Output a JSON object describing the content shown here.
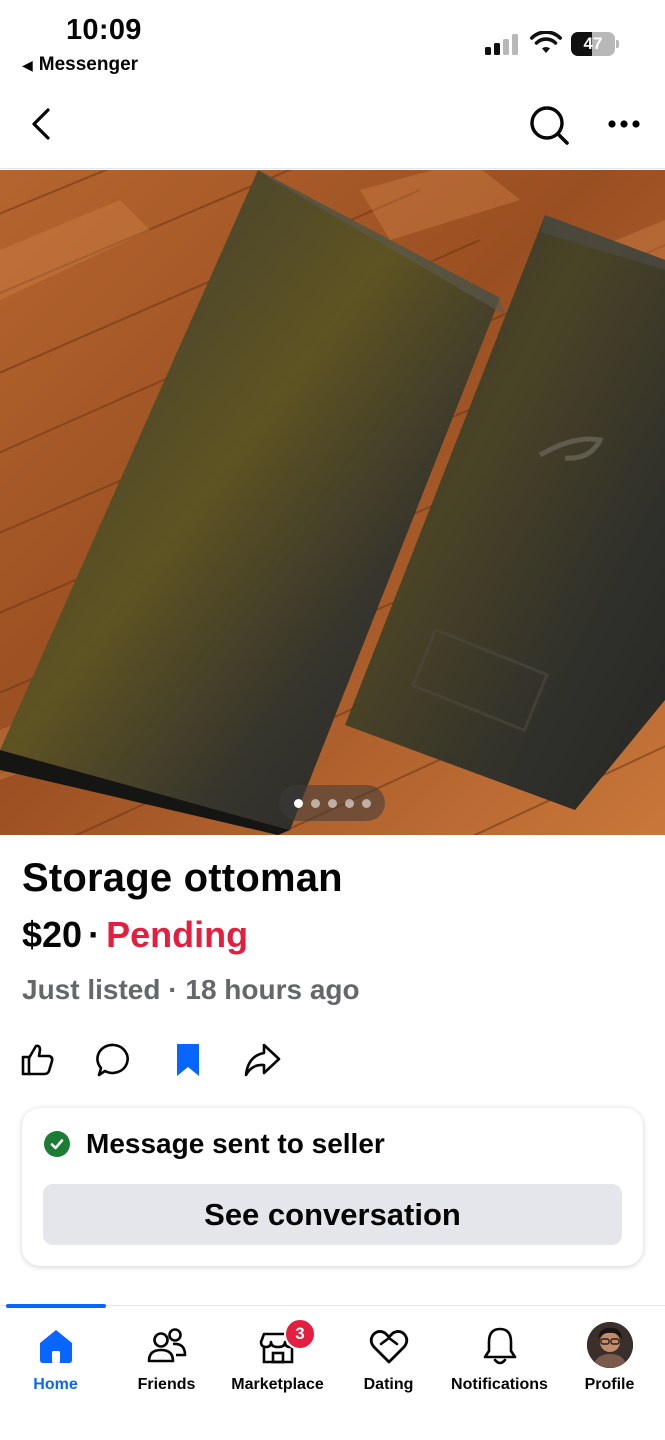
{
  "status_bar": {
    "time": "10:09",
    "back_app": "Messenger",
    "battery_level": "47",
    "battery_fraction": 0.47
  },
  "top_nav": {
    "back_icon": "chevron-left-icon",
    "search_icon": "search-icon",
    "more_icon": "more-horizontal-icon"
  },
  "photo": {
    "carousel_count": 5,
    "carousel_active_index": 0
  },
  "listing": {
    "title": "Storage ottoman",
    "price": "$20",
    "separator": "·",
    "status": "Pending",
    "meta": "Just listed · 18 hours ago",
    "status_color": "#e41e3f"
  },
  "actions": {
    "like_icon": "thumbs-up-icon",
    "comment_icon": "comment-icon",
    "save_icon": "bookmark-filled-icon",
    "share_icon": "share-icon"
  },
  "message_card": {
    "status_text": "Message sent to seller",
    "button_label": "See conversation",
    "check_color": "#1b7d33"
  },
  "tabbar": {
    "active_color": "#0866ff",
    "tabs": [
      {
        "label": "Home",
        "icon": "home-icon",
        "active": true
      },
      {
        "label": "Friends",
        "icon": "friends-icon",
        "active": false
      },
      {
        "label": "Marketplace",
        "icon": "marketplace-icon",
        "active": false,
        "badge": "3"
      },
      {
        "label": "Dating",
        "icon": "heart-icon",
        "active": false
      },
      {
        "label": "Notifications",
        "icon": "bell-icon",
        "active": false
      },
      {
        "label": "Profile",
        "icon": "avatar",
        "active": false
      }
    ]
  }
}
